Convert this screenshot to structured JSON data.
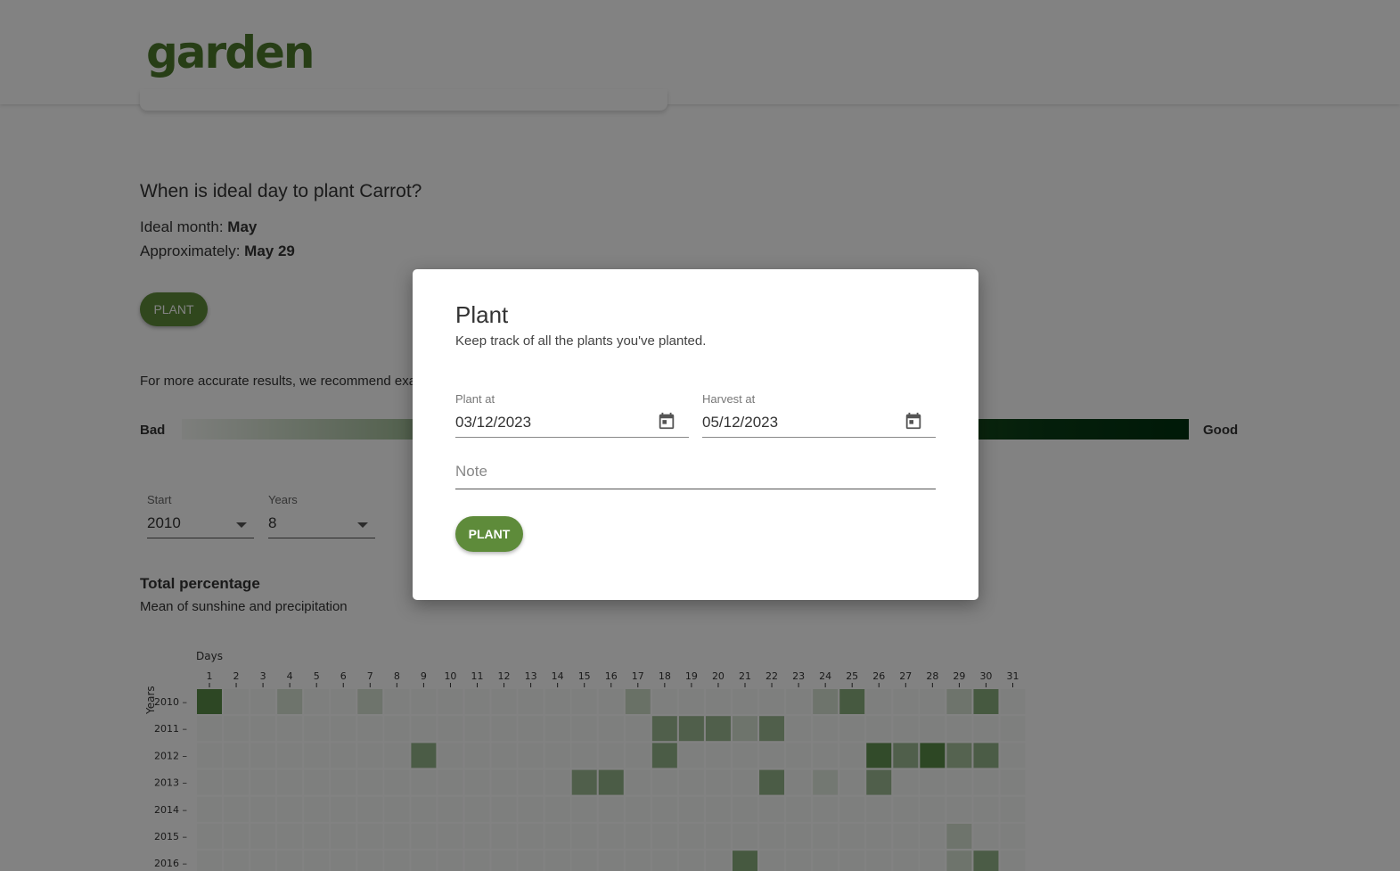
{
  "app": {
    "logo": "garden"
  },
  "page": {
    "question": "When is ideal day to plant Carrot?",
    "ideal_month_label": "Ideal month:",
    "ideal_month_value": "May",
    "approx_label": "Approximately:",
    "approx_value": "May 29",
    "plant_button": "PLANT",
    "recommend_text": "For more accurate results, we recommend exa",
    "scale": {
      "bad": "Bad",
      "good": "Good"
    },
    "start": {
      "label": "Start",
      "value": "2010"
    },
    "years": {
      "label": "Years",
      "value": "8"
    },
    "total_title": "Total percentage",
    "total_subtitle": "Mean of sunshine and precipitation"
  },
  "colors": {
    "accent": "#5e8b3a",
    "logo": "#4e7a2c",
    "scale_dark": "#003210"
  },
  "chart_data": {
    "type": "heatmap",
    "xlabel": "Days",
    "ylabel": "Years",
    "x": [
      1,
      2,
      3,
      4,
      5,
      6,
      7,
      8,
      9,
      10,
      11,
      12,
      13,
      14,
      15,
      16,
      17,
      18,
      19,
      20,
      21,
      22,
      23,
      24,
      25,
      26,
      27,
      28,
      29,
      30,
      31
    ],
    "y": [
      "2010",
      "2011",
      "2012",
      "2013",
      "2014",
      "2015",
      "2016"
    ],
    "cells": [
      {
        "year": "2010",
        "day": 1,
        "level": 0.85
      },
      {
        "year": "2010",
        "day": 4,
        "level": 0.2
      },
      {
        "year": "2010",
        "day": 7,
        "level": 0.2
      },
      {
        "year": "2010",
        "day": 17,
        "level": 0.25
      },
      {
        "year": "2010",
        "day": 24,
        "level": 0.2
      },
      {
        "year": "2010",
        "day": 25,
        "level": 0.6
      },
      {
        "year": "2010",
        "day": 29,
        "level": 0.2
      },
      {
        "year": "2010",
        "day": 30,
        "level": 0.6
      },
      {
        "year": "2011",
        "day": 18,
        "level": 0.5
      },
      {
        "year": "2011",
        "day": 19,
        "level": 0.5
      },
      {
        "year": "2011",
        "day": 20,
        "level": 0.5
      },
      {
        "year": "2011",
        "day": 21,
        "level": 0.2
      },
      {
        "year": "2011",
        "day": 22,
        "level": 0.5
      },
      {
        "year": "2012",
        "day": 9,
        "level": 0.55
      },
      {
        "year": "2012",
        "day": 18,
        "level": 0.55
      },
      {
        "year": "2012",
        "day": 26,
        "level": 0.8
      },
      {
        "year": "2012",
        "day": 27,
        "level": 0.5
      },
      {
        "year": "2012",
        "day": 28,
        "level": 0.85
      },
      {
        "year": "2012",
        "day": 29,
        "level": 0.45
      },
      {
        "year": "2012",
        "day": 30,
        "level": 0.55
      },
      {
        "year": "2013",
        "day": 15,
        "level": 0.5
      },
      {
        "year": "2013",
        "day": 16,
        "level": 0.55
      },
      {
        "year": "2013",
        "day": 22,
        "level": 0.55
      },
      {
        "year": "2013",
        "day": 24,
        "level": 0.15
      },
      {
        "year": "2013",
        "day": 26,
        "level": 0.5
      },
      {
        "year": "2015",
        "day": 29,
        "level": 0.2
      },
      {
        "year": "2016",
        "day": 21,
        "level": 0.6
      },
      {
        "year": "2016",
        "day": 29,
        "level": 0.2
      },
      {
        "year": "2016",
        "day": 30,
        "level": 0.55
      }
    ]
  },
  "modal": {
    "title": "Plant",
    "subtitle": "Keep track of all the plants you've planted.",
    "plant_at": {
      "label": "Plant at",
      "value": "03/12/2023"
    },
    "harvest_at": {
      "label": "Harvest at",
      "value": "05/12/2023"
    },
    "note_placeholder": "Note",
    "submit": "PLANT",
    "calendar_icon": "calendar-icon"
  }
}
